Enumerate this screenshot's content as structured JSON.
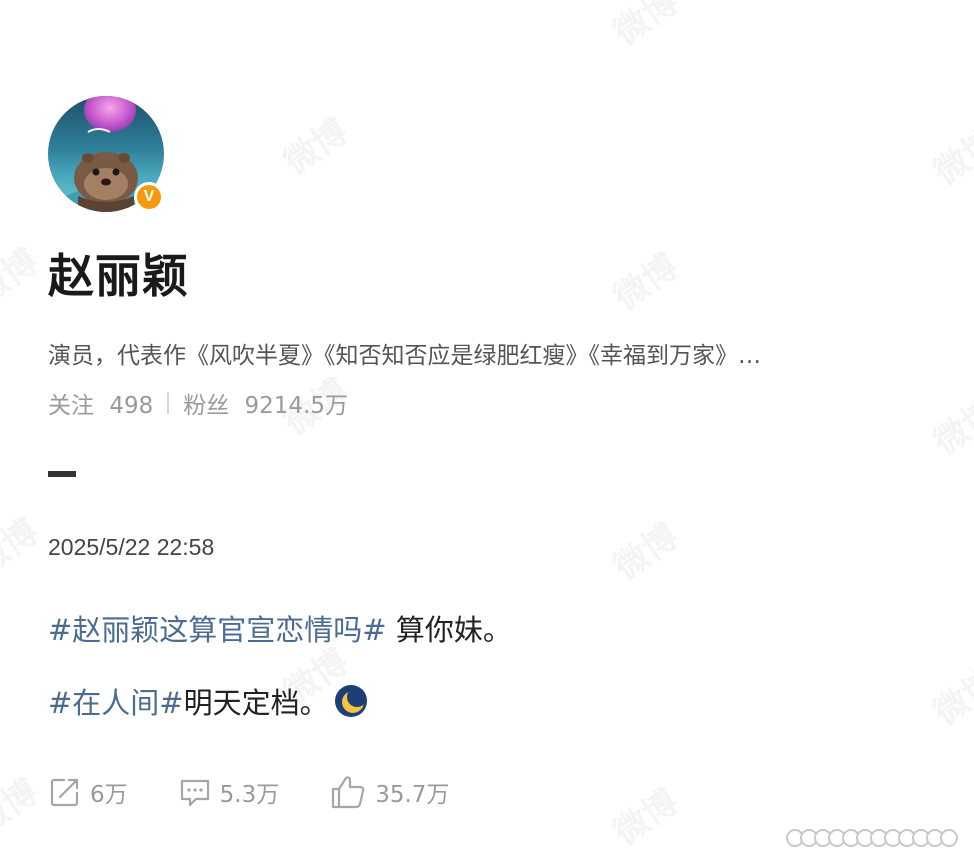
{
  "profile": {
    "name": "赵丽颖",
    "verified_badge": "V",
    "bio": "演员，代表作《风吹半夏》《知否知否应是绿肥红瘦》《幸福到万家》…",
    "following_label": "关注",
    "following_count": "498",
    "followers_label": "粉丝",
    "followers_count": "9214.5万"
  },
  "post": {
    "timestamp": "2025/5/22 22:58",
    "line1_topic": "#赵丽颖这算官宣恋情吗#",
    "line1_text": " 算你妹。",
    "line2_topic": "#在人间#",
    "line2_text": "明天定档。",
    "emoji": "moon-emoji"
  },
  "actions": {
    "repost_count": "6万",
    "comment_count": "5.3万",
    "like_count": "35.7万"
  },
  "watermark_text": "微博",
  "colors": {
    "topic_link": "#4a6c91",
    "verified_badge": "#f59a0c",
    "muted_text": "#9a9a9a"
  }
}
